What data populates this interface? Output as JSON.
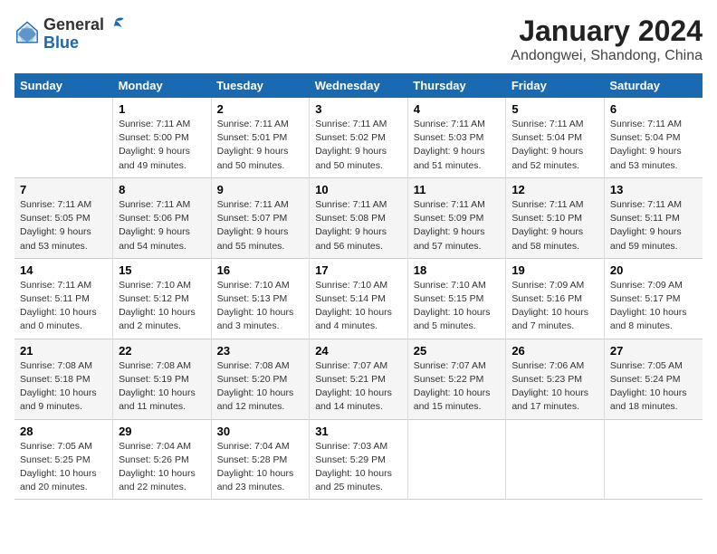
{
  "logo": {
    "general": "General",
    "blue": "Blue"
  },
  "title": "January 2024",
  "subtitle": "Andongwei, Shandong, China",
  "days_of_week": [
    "Sunday",
    "Monday",
    "Tuesday",
    "Wednesday",
    "Thursday",
    "Friday",
    "Saturday"
  ],
  "weeks": [
    [
      {
        "day": "",
        "info": ""
      },
      {
        "day": "1",
        "info": "Sunrise: 7:11 AM\nSunset: 5:00 PM\nDaylight: 9 hours\nand 49 minutes."
      },
      {
        "day": "2",
        "info": "Sunrise: 7:11 AM\nSunset: 5:01 PM\nDaylight: 9 hours\nand 50 minutes."
      },
      {
        "day": "3",
        "info": "Sunrise: 7:11 AM\nSunset: 5:02 PM\nDaylight: 9 hours\nand 50 minutes."
      },
      {
        "day": "4",
        "info": "Sunrise: 7:11 AM\nSunset: 5:03 PM\nDaylight: 9 hours\nand 51 minutes."
      },
      {
        "day": "5",
        "info": "Sunrise: 7:11 AM\nSunset: 5:04 PM\nDaylight: 9 hours\nand 52 minutes."
      },
      {
        "day": "6",
        "info": "Sunrise: 7:11 AM\nSunset: 5:04 PM\nDaylight: 9 hours\nand 53 minutes."
      }
    ],
    [
      {
        "day": "7",
        "info": "Sunrise: 7:11 AM\nSunset: 5:05 PM\nDaylight: 9 hours\nand 53 minutes."
      },
      {
        "day": "8",
        "info": "Sunrise: 7:11 AM\nSunset: 5:06 PM\nDaylight: 9 hours\nand 54 minutes."
      },
      {
        "day": "9",
        "info": "Sunrise: 7:11 AM\nSunset: 5:07 PM\nDaylight: 9 hours\nand 55 minutes."
      },
      {
        "day": "10",
        "info": "Sunrise: 7:11 AM\nSunset: 5:08 PM\nDaylight: 9 hours\nand 56 minutes."
      },
      {
        "day": "11",
        "info": "Sunrise: 7:11 AM\nSunset: 5:09 PM\nDaylight: 9 hours\nand 57 minutes."
      },
      {
        "day": "12",
        "info": "Sunrise: 7:11 AM\nSunset: 5:10 PM\nDaylight: 9 hours\nand 58 minutes."
      },
      {
        "day": "13",
        "info": "Sunrise: 7:11 AM\nSunset: 5:11 PM\nDaylight: 9 hours\nand 59 minutes."
      }
    ],
    [
      {
        "day": "14",
        "info": "Sunrise: 7:11 AM\nSunset: 5:11 PM\nDaylight: 10 hours\nand 0 minutes."
      },
      {
        "day": "15",
        "info": "Sunrise: 7:10 AM\nSunset: 5:12 PM\nDaylight: 10 hours\nand 2 minutes."
      },
      {
        "day": "16",
        "info": "Sunrise: 7:10 AM\nSunset: 5:13 PM\nDaylight: 10 hours\nand 3 minutes."
      },
      {
        "day": "17",
        "info": "Sunrise: 7:10 AM\nSunset: 5:14 PM\nDaylight: 10 hours\nand 4 minutes."
      },
      {
        "day": "18",
        "info": "Sunrise: 7:10 AM\nSunset: 5:15 PM\nDaylight: 10 hours\nand 5 minutes."
      },
      {
        "day": "19",
        "info": "Sunrise: 7:09 AM\nSunset: 5:16 PM\nDaylight: 10 hours\nand 7 minutes."
      },
      {
        "day": "20",
        "info": "Sunrise: 7:09 AM\nSunset: 5:17 PM\nDaylight: 10 hours\nand 8 minutes."
      }
    ],
    [
      {
        "day": "21",
        "info": "Sunrise: 7:08 AM\nSunset: 5:18 PM\nDaylight: 10 hours\nand 9 minutes."
      },
      {
        "day": "22",
        "info": "Sunrise: 7:08 AM\nSunset: 5:19 PM\nDaylight: 10 hours\nand 11 minutes."
      },
      {
        "day": "23",
        "info": "Sunrise: 7:08 AM\nSunset: 5:20 PM\nDaylight: 10 hours\nand 12 minutes."
      },
      {
        "day": "24",
        "info": "Sunrise: 7:07 AM\nSunset: 5:21 PM\nDaylight: 10 hours\nand 14 minutes."
      },
      {
        "day": "25",
        "info": "Sunrise: 7:07 AM\nSunset: 5:22 PM\nDaylight: 10 hours\nand 15 minutes."
      },
      {
        "day": "26",
        "info": "Sunrise: 7:06 AM\nSunset: 5:23 PM\nDaylight: 10 hours\nand 17 minutes."
      },
      {
        "day": "27",
        "info": "Sunrise: 7:05 AM\nSunset: 5:24 PM\nDaylight: 10 hours\nand 18 minutes."
      }
    ],
    [
      {
        "day": "28",
        "info": "Sunrise: 7:05 AM\nSunset: 5:25 PM\nDaylight: 10 hours\nand 20 minutes."
      },
      {
        "day": "29",
        "info": "Sunrise: 7:04 AM\nSunset: 5:26 PM\nDaylight: 10 hours\nand 22 minutes."
      },
      {
        "day": "30",
        "info": "Sunrise: 7:04 AM\nSunset: 5:28 PM\nDaylight: 10 hours\nand 23 minutes."
      },
      {
        "day": "31",
        "info": "Sunrise: 7:03 AM\nSunset: 5:29 PM\nDaylight: 10 hours\nand 25 minutes."
      },
      {
        "day": "",
        "info": ""
      },
      {
        "day": "",
        "info": ""
      },
      {
        "day": "",
        "info": ""
      }
    ]
  ]
}
